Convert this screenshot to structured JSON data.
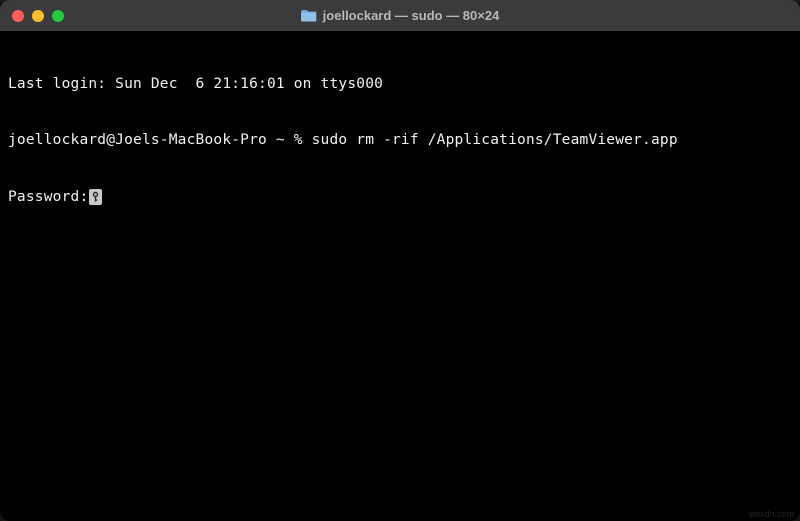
{
  "titlebar": {
    "title": "joellockard — sudo — 80×24",
    "folder_icon": "folder-icon"
  },
  "terminal": {
    "last_login": "Last login: Sun Dec  6 21:16:01 on ttys000",
    "prompt_user_host": "joellockard@Joels-MacBook-Pro ~ % ",
    "command": "sudo rm -rif /Applications/TeamViewer.app",
    "password_prompt": "Password:"
  },
  "watermark": "wsxdn.com"
}
